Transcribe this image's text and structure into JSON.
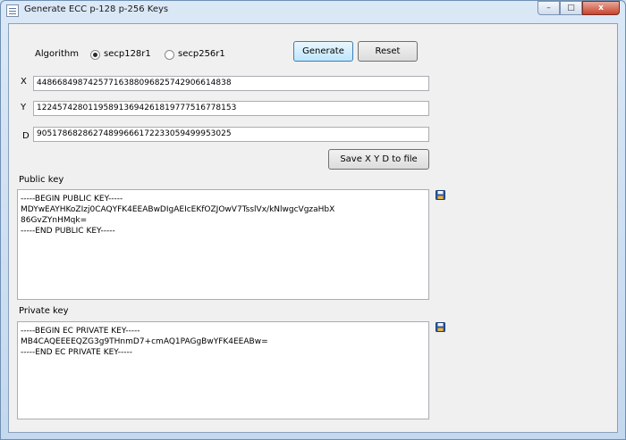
{
  "window": {
    "title": "Generate ECC p-128 p-256 Keys"
  },
  "caption_buttons": {
    "minimize": "–",
    "maximize": "□",
    "close": "x"
  },
  "algorithm": {
    "label": "Algorithm",
    "options": [
      {
        "label": "secp128r1",
        "selected": true
      },
      {
        "label": "secp256r1",
        "selected": false
      }
    ]
  },
  "buttons": {
    "generate": "Generate",
    "reset": "Reset",
    "save_xyd": "Save X Y D to file"
  },
  "fields": {
    "x": {
      "label": "X",
      "value": "44866849874257716388096825742906614838"
    },
    "y": {
      "label": "Y",
      "value": "122457428011958913694261819777516778153"
    },
    "d": {
      "label": "D",
      "value": "90517868286274899666172233059499953025"
    }
  },
  "public_key": {
    "label": "Public key",
    "text": "-----BEGIN PUBLIC KEY-----\nMDYwEAYHKoZIzj0CAQYFK4EEABwDIgAEIcEKfOZJOwV7TsslVx/kNlwgcVgzaHbX\n86GvZYnHMqk=\n-----END PUBLIC KEY-----",
    "save_icon": "floppy-disk-icon"
  },
  "private_key": {
    "label": "Private key",
    "text": "-----BEGIN EC PRIVATE KEY-----\nMB4CAQEEEEQZG3g9THnmD7+cmAQ1PAGgBwYFK4EEABw=\n-----END EC PRIVATE KEY-----",
    "save_icon": "floppy-disk-icon"
  }
}
